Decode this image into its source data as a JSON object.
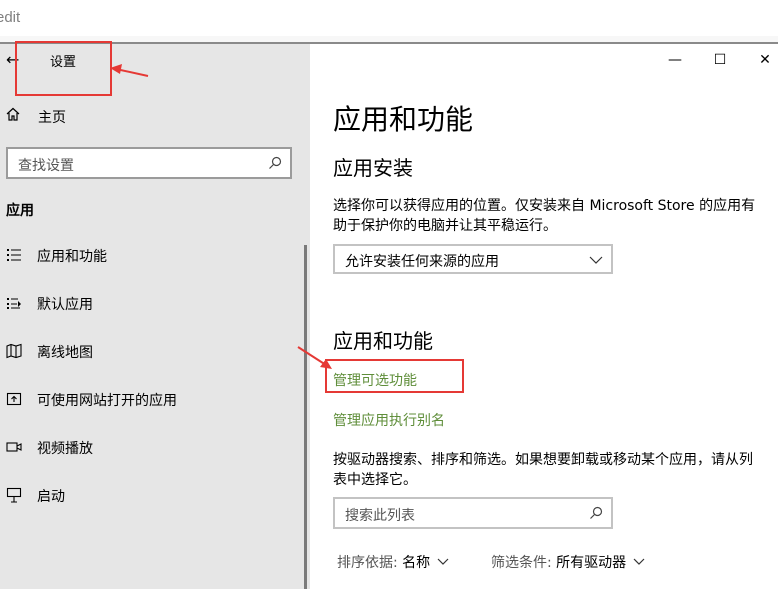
{
  "address_bar": {
    "text": "edit"
  },
  "window": {
    "title": "设置",
    "controls": {
      "minimize": "—",
      "maximize": "☐",
      "close": "✕"
    }
  },
  "sidebar": {
    "home_label": "主页",
    "search_placeholder": "查找设置",
    "section_label": "应用",
    "items": [
      {
        "label": "应用和功能",
        "icon": "apps-features-icon"
      },
      {
        "label": "默认应用",
        "icon": "default-apps-icon"
      },
      {
        "label": "离线地图",
        "icon": "offline-maps-icon"
      },
      {
        "label": "可使用网站打开的应用",
        "icon": "apps-for-websites-icon"
      },
      {
        "label": "视频播放",
        "icon": "video-playback-icon"
      },
      {
        "label": "启动",
        "icon": "startup-icon"
      }
    ]
  },
  "main": {
    "page_title": "应用和功能",
    "install_heading": "应用安装",
    "install_desc": "选择你可以获得应用的位置。仅安装来自 Microsoft Store 的应用有助于保护你的电脑并让其平稳运行。",
    "install_dropdown_value": "允许安装任何来源的应用",
    "features_heading": "应用和功能",
    "link_optional_features": "管理可选功能",
    "link_execution_alias": "管理应用执行别名",
    "search_desc": "按驱动器搜索、排序和筛选。如果想要卸载或移动某个应用，请从列表中选择它。",
    "search_placeholder": "搜索此列表",
    "sort_label": "排序依据:",
    "sort_value": "名称",
    "filter_label": "筛选条件:",
    "filter_value": "所有驱动器"
  },
  "colors": {
    "annotation": "#e53935",
    "link": "#5f8e3a",
    "sidebar_bg": "#e6e6e6"
  }
}
